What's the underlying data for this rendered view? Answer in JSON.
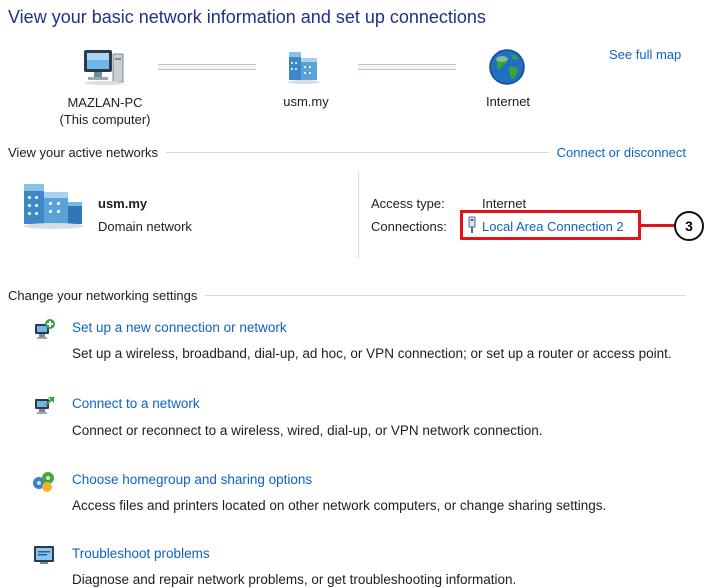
{
  "header": {
    "title": "View your basic network information and set up connections",
    "see_full_map": "See full map"
  },
  "map": {
    "computer_name": "MAZLAN-PC",
    "computer_sub": "(This computer)",
    "network_name": "usm.my",
    "internet_label": "Internet"
  },
  "active_networks": {
    "heading": "View your active networks",
    "connect_link": "Connect or disconnect",
    "network_name": "usm.my",
    "network_type": "Domain network",
    "access_type_label": "Access type:",
    "access_type_value": "Internet",
    "connections_label": "Connections:",
    "connection_name": "Local Area Connection 2"
  },
  "callout": {
    "number": "3",
    "color": "#e0141a"
  },
  "settings": {
    "heading": "Change your networking settings",
    "tasks": [
      {
        "icon": "new-connection-icon",
        "title": "Set up a new connection or network",
        "desc": "Set up a wireless, broadband, dial-up, ad hoc, or VPN connection; or set up a router or access point."
      },
      {
        "icon": "connect-network-icon",
        "title": "Connect to a network",
        "desc": "Connect or reconnect to a wireless, wired, dial-up, or VPN network connection."
      },
      {
        "icon": "homegroup-icon",
        "title": "Choose homegroup and sharing options",
        "desc": "Access files and printers located on other network computers, or change sharing settings."
      },
      {
        "icon": "troubleshoot-icon",
        "title": "Troubleshoot problems",
        "desc": "Diagnose and repair network problems, or get troubleshooting information."
      }
    ]
  },
  "colors": {
    "title": "#1e3287",
    "link": "#0d63c7",
    "highlight": "#e0141a"
  }
}
